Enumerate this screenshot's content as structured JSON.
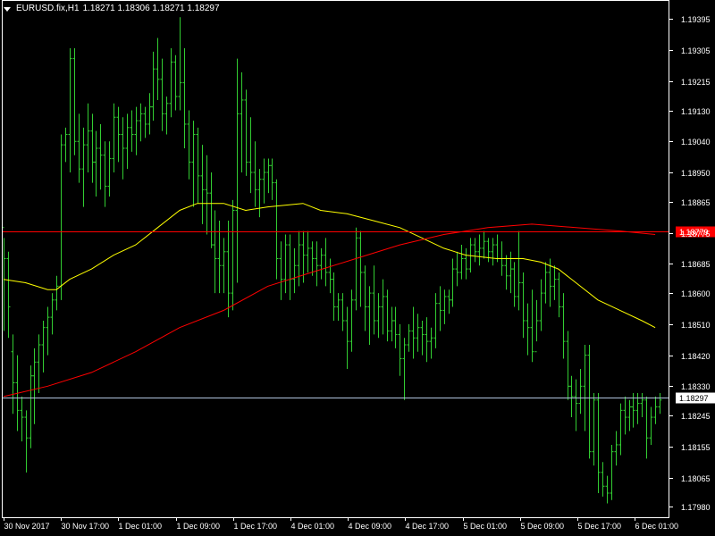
{
  "header": {
    "symbol": "EURUSD.fix,H1",
    "ohlc": "1.18271 1.18306 1.18271 1.18297"
  },
  "colors": {
    "background": "#000000",
    "candle": "#32CD32",
    "ma_fast": "#FFFF00",
    "ma_slow": "#FF0000",
    "resistance_line": "#FF0000",
    "bid_line": "#B0C4DE",
    "axis": "#FFFFFF"
  },
  "chart_data": {
    "type": "ohlc",
    "symbol": "EURUSD.fix",
    "timeframe": "H1",
    "price_ticks": [
      "1.19395",
      "1.19305",
      "1.19215",
      "1.19130",
      "1.19040",
      "1.18950",
      "1.18865",
      "1.18775",
      "1.18685",
      "1.18600",
      "1.18510",
      "1.18420",
      "1.18330",
      "1.18245",
      "1.18155",
      "1.18065",
      "1.17980"
    ],
    "time_ticks": [
      "30 Nov 2017",
      "30 Nov 17:00",
      "1 Dec 01:00",
      "1 Dec 09:00",
      "1 Dec 17:00",
      "4 Dec 01:00",
      "4 Dec 09:00",
      "4 Dec 17:00",
      "5 Dec 01:00",
      "5 Dec 09:00",
      "5 Dec 17:00",
      "6 Dec 01:00"
    ],
    "ylim": [
      1.1795,
      1.1945
    ],
    "horizontal_lines": [
      {
        "name": "resistance",
        "price": 1.18779,
        "label": "1.18779"
      },
      {
        "name": "bid",
        "price": 1.18297,
        "label": "1.18297"
      }
    ],
    "moving_averages": [
      {
        "name": "ma-fast",
        "color": "#FFFF00",
        "points": [
          [
            0,
            1.1864
          ],
          [
            5,
            1.1863
          ],
          [
            10,
            1.1861
          ],
          [
            12,
            1.1861
          ],
          [
            15,
            1.1864
          ],
          [
            20,
            1.1867
          ],
          [
            25,
            1.1871
          ],
          [
            30,
            1.1874
          ],
          [
            35,
            1.1879
          ],
          [
            40,
            1.1884
          ],
          [
            44,
            1.1886
          ],
          [
            50,
            1.1886
          ],
          [
            55,
            1.1884
          ],
          [
            60,
            1.1885
          ],
          [
            68,
            1.1886
          ],
          [
            72,
            1.1884
          ],
          [
            78,
            1.1883
          ],
          [
            84,
            1.1881
          ],
          [
            90,
            1.1879
          ],
          [
            95,
            1.1876
          ],
          [
            100,
            1.1873
          ],
          [
            105,
            1.1871
          ],
          [
            112,
            1.187
          ],
          [
            118,
            1.187
          ],
          [
            122,
            1.1869
          ],
          [
            126,
            1.1867
          ],
          [
            130,
            1.1863
          ],
          [
            135,
            1.1858
          ],
          [
            140,
            1.1855
          ],
          [
            145,
            1.1852
          ],
          [
            148,
            1.185
          ]
        ]
      },
      {
        "name": "ma-slow",
        "color": "#FF0000",
        "points": [
          [
            0,
            1.183
          ],
          [
            10,
            1.1833
          ],
          [
            20,
            1.1837
          ],
          [
            30,
            1.1843
          ],
          [
            40,
            1.185
          ],
          [
            50,
            1.1855
          ],
          [
            60,
            1.1862
          ],
          [
            70,
            1.1866
          ],
          [
            80,
            1.187
          ],
          [
            90,
            1.1874
          ],
          [
            100,
            1.1877
          ],
          [
            110,
            1.1879
          ],
          [
            120,
            1.188
          ],
          [
            130,
            1.1879
          ],
          [
            140,
            1.1878
          ],
          [
            148,
            1.1877
          ]
        ]
      }
    ],
    "bars": [
      [
        1.1879,
        1.1876,
        1.1849,
        1.187
      ],
      [
        1.187,
        1.1872,
        1.1847,
        1.1856
      ],
      [
        1.1843,
        1.1848,
        1.1825,
        1.1834
      ],
      [
        1.1834,
        1.1842,
        1.182,
        1.1826
      ],
      [
        1.1826,
        1.183,
        1.1817,
        1.1824
      ],
      [
        1.1824,
        1.1826,
        1.1808,
        1.1818
      ],
      [
        1.1818,
        1.1839,
        1.1815,
        1.1836
      ],
      [
        1.1836,
        1.1844,
        1.1822,
        1.184
      ],
      [
        1.184,
        1.1848,
        1.1831,
        1.1845
      ],
      [
        1.1845,
        1.1852,
        1.1837,
        1.185
      ],
      [
        1.185,
        1.1856,
        1.1842,
        1.1853
      ],
      [
        1.1853,
        1.186,
        1.1848,
        1.1858
      ],
      [
        1.1858,
        1.1865,
        1.1855,
        1.1862
      ],
      [
        1.1862,
        1.1906,
        1.1858,
        1.1903
      ],
      [
        1.1903,
        1.1908,
        1.1898,
        1.1906
      ],
      [
        1.1906,
        1.1931,
        1.1895,
        1.1928
      ],
      [
        1.1928,
        1.1931,
        1.19,
        1.1904
      ],
      [
        1.1904,
        1.1912,
        1.1892,
        1.1896
      ],
      [
        1.1896,
        1.1908,
        1.1885,
        1.1903
      ],
      [
        1.1903,
        1.1915,
        1.1895,
        1.1907
      ],
      [
        1.1907,
        1.1912,
        1.1892,
        1.1898
      ],
      [
        1.1898,
        1.1907,
        1.1888,
        1.1902
      ],
      [
        1.1902,
        1.1909,
        1.189,
        1.19
      ],
      [
        1.19,
        1.1904,
        1.1885,
        1.1891
      ],
      [
        1.1891,
        1.1904,
        1.1888,
        1.1899
      ],
      [
        1.1899,
        1.1915,
        1.1895,
        1.1911
      ],
      [
        1.1911,
        1.1914,
        1.1898,
        1.1906
      ],
      [
        1.1906,
        1.1911,
        1.1893,
        1.1902
      ],
      [
        1.1902,
        1.1912,
        1.1896,
        1.1908
      ],
      [
        1.1908,
        1.1913,
        1.1901,
        1.1906
      ],
      [
        1.1906,
        1.1914,
        1.19,
        1.191
      ],
      [
        1.191,
        1.1915,
        1.1904,
        1.1912
      ],
      [
        1.1912,
        1.1914,
        1.1905,
        1.1909
      ],
      [
        1.1909,
        1.1918,
        1.1906,
        1.1914
      ],
      [
        1.1914,
        1.193,
        1.191,
        1.1925
      ],
      [
        1.1925,
        1.1934,
        1.1916,
        1.1922
      ],
      [
        1.1922,
        1.1928,
        1.1907,
        1.1912
      ],
      [
        1.1912,
        1.1917,
        1.1906,
        1.1915
      ],
      [
        1.1915,
        1.1931,
        1.1911,
        1.1927
      ],
      [
        1.1927,
        1.1929,
        1.1913,
        1.1917
      ],
      [
        1.1917,
        1.194,
        1.1913,
        1.1921
      ],
      [
        1.1921,
        1.1931,
        1.1902,
        1.1909
      ],
      [
        1.1909,
        1.1913,
        1.1893,
        1.1898
      ],
      [
        1.1898,
        1.191,
        1.1885,
        1.1906
      ],
      [
        1.1906,
        1.1908,
        1.1886,
        1.1894
      ],
      [
        1.1894,
        1.1903,
        1.188,
        1.189
      ],
      [
        1.189,
        1.19,
        1.1877,
        1.1889
      ],
      [
        1.1889,
        1.1895,
        1.1873,
        1.1874
      ],
      [
        1.1874,
        1.1884,
        1.186,
        1.187
      ],
      [
        1.187,
        1.1881,
        1.186,
        1.1868
      ],
      [
        1.1868,
        1.1876,
        1.186,
        1.1872
      ],
      [
        1.1872,
        1.1881,
        1.1853,
        1.186
      ],
      [
        1.186,
        1.1887,
        1.1855,
        1.1884
      ],
      [
        1.1884,
        1.1928,
        1.1863,
        1.1912
      ],
      [
        1.1912,
        1.1924,
        1.1895,
        1.1916
      ],
      [
        1.1916,
        1.1919,
        1.1894,
        1.1898
      ],
      [
        1.1898,
        1.1911,
        1.1889,
        1.1895
      ],
      [
        1.1895,
        1.1904,
        1.1885,
        1.189
      ],
      [
        1.189,
        1.1896,
        1.1882,
        1.1893
      ],
      [
        1.1893,
        1.1899,
        1.1886,
        1.1895
      ],
      [
        1.1895,
        1.1899,
        1.1889,
        1.1897
      ],
      [
        1.1897,
        1.1899,
        1.1887,
        1.1892
      ],
      [
        1.1892,
        1.1893,
        1.1864,
        1.187
      ],
      [
        1.187,
        1.1875,
        1.1858,
        1.1864
      ],
      [
        1.1864,
        1.1877,
        1.186,
        1.1874
      ],
      [
        1.1874,
        1.1877,
        1.1858,
        1.1864
      ],
      [
        1.1864,
        1.1873,
        1.186,
        1.1868
      ],
      [
        1.1868,
        1.1878,
        1.1862,
        1.1874
      ],
      [
        1.1874,
        1.1878,
        1.1863,
        1.1871
      ],
      [
        1.1871,
        1.1878,
        1.1866,
        1.1873
      ],
      [
        1.1873,
        1.1875,
        1.1865,
        1.187
      ],
      [
        1.187,
        1.1875,
        1.1862,
        1.1868
      ],
      [
        1.1868,
        1.1873,
        1.1864,
        1.1871
      ],
      [
        1.1871,
        1.1876,
        1.1862,
        1.1866
      ],
      [
        1.1866,
        1.187,
        1.186,
        1.1864
      ],
      [
        1.1864,
        1.1866,
        1.1852,
        1.1856
      ],
      [
        1.1856,
        1.186,
        1.1852,
        1.1858
      ],
      [
        1.1858,
        1.186,
        1.1849,
        1.1852
      ],
      [
        1.1852,
        1.1856,
        1.1838,
        1.1846
      ],
      [
        1.1846,
        1.1861,
        1.1843,
        1.1858
      ],
      [
        1.1858,
        1.1879,
        1.1855,
        1.1876
      ],
      [
        1.1876,
        1.1878,
        1.1856,
        1.1866
      ],
      [
        1.1866,
        1.1868,
        1.1849,
        1.1856
      ],
      [
        1.1856,
        1.1862,
        1.1845,
        1.186
      ],
      [
        1.186,
        1.1868,
        1.1848,
        1.1852
      ],
      [
        1.1852,
        1.186,
        1.1847,
        1.1856
      ],
      [
        1.1856,
        1.1864,
        1.1848,
        1.1859
      ],
      [
        1.1859,
        1.1861,
        1.1846,
        1.1849
      ],
      [
        1.1849,
        1.1856,
        1.1846,
        1.1852
      ],
      [
        1.1852,
        1.1856,
        1.1844,
        1.1848
      ],
      [
        1.1848,
        1.1851,
        1.1836,
        1.1841
      ],
      [
        1.1841,
        1.1847,
        1.1829,
        1.1845
      ],
      [
        1.1845,
        1.1851,
        1.1843,
        1.1849
      ],
      [
        1.1849,
        1.1856,
        1.1841,
        1.1847
      ],
      [
        1.1847,
        1.1854,
        1.1843,
        1.185
      ],
      [
        1.185,
        1.1852,
        1.1842,
        1.1848
      ],
      [
        1.1848,
        1.1853,
        1.184,
        1.1846
      ],
      [
        1.1846,
        1.185,
        1.1841,
        1.1847
      ],
      [
        1.1847,
        1.186,
        1.1844,
        1.1857
      ],
      [
        1.1857,
        1.1862,
        1.1849,
        1.1855
      ],
      [
        1.1855,
        1.1861,
        1.1851,
        1.1859
      ],
      [
        1.1859,
        1.1861,
        1.1854,
        1.1858
      ],
      [
        1.1858,
        1.187,
        1.1856,
        1.1867
      ],
      [
        1.1867,
        1.1872,
        1.1862,
        1.1866
      ],
      [
        1.1866,
        1.1874,
        1.1864,
        1.187
      ],
      [
        1.187,
        1.1873,
        1.1864,
        1.1867
      ],
      [
        1.1867,
        1.1876,
        1.1866,
        1.1874
      ],
      [
        1.1874,
        1.1876,
        1.1869,
        1.1872
      ],
      [
        1.1872,
        1.1877,
        1.1868,
        1.1873
      ],
      [
        1.1873,
        1.1878,
        1.187,
        1.1875
      ],
      [
        1.1875,
        1.1876,
        1.1869,
        1.1872
      ],
      [
        1.1872,
        1.1876,
        1.1868,
        1.1874
      ],
      [
        1.1874,
        1.1877,
        1.1869,
        1.187
      ],
      [
        1.187,
        1.1875,
        1.1865,
        1.1868
      ],
      [
        1.1868,
        1.1871,
        1.1861,
        1.1865
      ],
      [
        1.1865,
        1.1872,
        1.186,
        1.1867
      ],
      [
        1.1867,
        1.1869,
        1.1856,
        1.1859
      ],
      [
        1.1859,
        1.1878,
        1.1855,
        1.1863
      ],
      [
        1.1863,
        1.1866,
        1.1847,
        1.1852
      ],
      [
        1.1852,
        1.1857,
        1.1842,
        1.185
      ],
      [
        1.185,
        1.1861,
        1.184,
        1.1843
      ],
      [
        1.1843,
        1.1858,
        1.1846,
        1.1852
      ],
      [
        1.1852,
        1.1864,
        1.1849,
        1.186
      ],
      [
        1.186,
        1.1869,
        1.1857,
        1.1866
      ],
      [
        1.1866,
        1.187,
        1.1856,
        1.1862
      ],
      [
        1.1862,
        1.1868,
        1.1858,
        1.1864
      ],
      [
        1.1864,
        1.1866,
        1.1853,
        1.1856
      ],
      [
        1.1856,
        1.186,
        1.1841,
        1.1846
      ],
      [
        1.1846,
        1.1849,
        1.1829,
        1.1833
      ],
      [
        1.1833,
        1.1836,
        1.1824,
        1.183
      ],
      [
        1.183,
        1.1835,
        1.182,
        1.1828
      ],
      [
        1.1828,
        1.1838,
        1.1825,
        1.1833
      ],
      [
        1.1833,
        1.1845,
        1.182,
        1.1842
      ],
      [
        1.1842,
        1.1845,
        1.1812,
        1.1814
      ],
      [
        1.1814,
        1.1831,
        1.181,
        1.1829
      ],
      [
        1.1829,
        1.1831,
        1.1802,
        1.1808
      ],
      [
        1.1808,
        1.1811,
        1.1801,
        1.1804
      ],
      [
        1.1804,
        1.1807,
        1.1799,
        1.1802
      ],
      [
        1.1802,
        1.1816,
        1.18,
        1.1814
      ],
      [
        1.1814,
        1.182,
        1.181,
        1.1816
      ],
      [
        1.1816,
        1.1828,
        1.1813,
        1.1826
      ],
      [
        1.1826,
        1.183,
        1.1819,
        1.1824
      ],
      [
        1.1824,
        1.1829,
        1.182,
        1.1827
      ],
      [
        1.1827,
        1.1831,
        1.1821,
        1.1826
      ],
      [
        1.1826,
        1.1831,
        1.1822,
        1.1828
      ],
      [
        1.1828,
        1.1831,
        1.1824,
        1.1829
      ],
      [
        1.1829,
        1.183,
        1.1812,
        1.1818
      ],
      [
        1.1818,
        1.1827,
        1.1816,
        1.1824
      ],
      [
        1.1824,
        1.183,
        1.1822,
        1.1827
      ],
      [
        1.1827,
        1.1831,
        1.1825,
        1.1829
      ]
    ]
  }
}
